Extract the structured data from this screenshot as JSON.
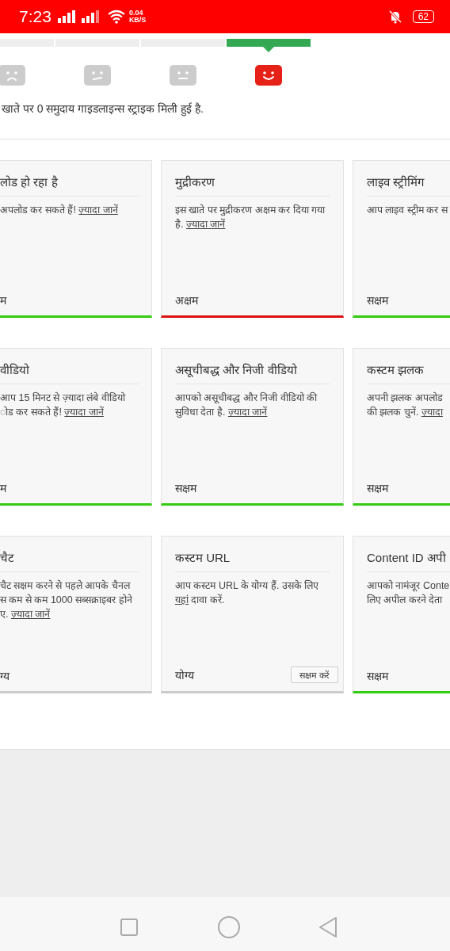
{
  "status_bar": {
    "time": "7:23",
    "speed_value": "0.04",
    "speed_unit": "KB/S",
    "battery": "62"
  },
  "strike_meter": [
    {
      "selected": false
    },
    {
      "selected": false
    },
    {
      "selected": false
    },
    {
      "selected": true
    }
  ],
  "strike_message": "खाते पर 0 समुदाय गाइडलाइन्स स्ट्राइक मिली हुई है.",
  "features": [
    {
      "title": "लोड हो रहा है",
      "lines": [
        [
          {
            "text": "अपलोड कर सकते हैं! "
          },
          {
            "link": "ज़्यादा जानें"
          }
        ]
      ],
      "status": "म",
      "kind": "enabled"
    },
    {
      "title": "मुद्रीकरण",
      "lines": [
        [
          {
            "text": "इस खाते पर मुद्रीकरण अक्षम कर दिया गया"
          }
        ],
        [
          {
            "text": "है. "
          },
          {
            "link": "ज़्यादा जानें"
          }
        ]
      ],
      "status": "अक्षम",
      "kind": "disabled"
    },
    {
      "title": "लाइव स्ट्रीमिंग",
      "lines": [
        [
          {
            "text": "आप लाइव स्ट्रीम कर स"
          }
        ]
      ],
      "status": "सक्षम",
      "kind": "enabled"
    },
    {
      "title": "वीडियो",
      "lines": [
        [
          {
            "text": "आप 15 मिनट से ज़्यादा लंबे वीडियो"
          }
        ],
        [
          {
            "text": "ोड कर सकते हैं! "
          },
          {
            "link": "ज़्यादा जानें"
          }
        ]
      ],
      "status": "म",
      "kind": "enabled"
    },
    {
      "title": "असूचीबद्ध और निजी वीडियो",
      "lines": [
        [
          {
            "text": "आपको असूचीबद्ध और निजी वीडियो की"
          }
        ],
        [
          {
            "text": "सुविधा देता है. "
          },
          {
            "link": "ज़्यादा जानें"
          }
        ]
      ],
      "status": "सक्षम",
      "kind": "enabled"
    },
    {
      "title": "कस्टम झलक",
      "lines": [
        [
          {
            "text": "अपनी झलक अपलोड"
          }
        ],
        [
          {
            "text": "की झलक चुनें. "
          },
          {
            "link": "ज़्यादा"
          }
        ]
      ],
      "status": "सक्षम",
      "kind": "enabled"
    },
    {
      "title": "चैट",
      "lines": [
        [
          {
            "text": "चैट सक्षम करने से पहले आपके चैनल"
          }
        ],
        [
          {
            "text": "स कम से कम 1000 सब्सक्राइबर होने"
          }
        ],
        [
          {
            "text": "ए. "
          },
          {
            "link": "ज़्यादा जानें"
          }
        ]
      ],
      "status": "ग्य",
      "kind": "eligible"
    },
    {
      "title": "कस्टम URL",
      "lines": [
        [
          {
            "text": "आप कस्टम URL के योग्य हैं. उसके लिए"
          }
        ],
        [
          {
            "link": "यहां"
          },
          {
            "text": " दावा करें."
          }
        ]
      ],
      "status": "योग्य",
      "kind": "eligible",
      "button": "सक्षम करें"
    },
    {
      "title": "Content ID अपी",
      "lines": [
        [
          {
            "text": "आपको नामंजूर Conte"
          }
        ],
        [
          {
            "text": "लिए अपील करने देता"
          }
        ]
      ],
      "status": "सक्षम",
      "kind": "enabled"
    }
  ]
}
